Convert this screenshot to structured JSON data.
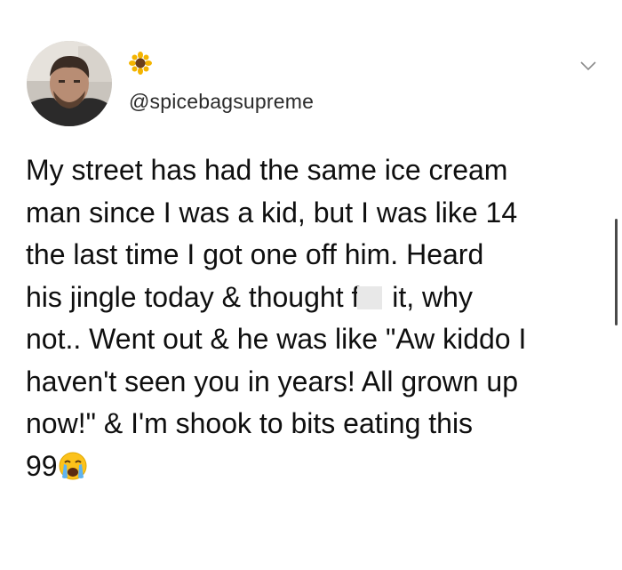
{
  "tweet": {
    "handle": "@spicebagsupreme",
    "name_emoji": "sunflower-icon",
    "lines": {
      "l1": "My street has had the same ice cream",
      "l2": "man since I was a kid, but I was like 14",
      "l3": "the last time I got one off him. Heard",
      "l4a": "his jingle today & thought f",
      "l4b": " it, why",
      "l5": "not.. Went out & he was like \"Aw kiddo I",
      "l6": "haven't seen you in years! All grown up",
      "l7": "now!\" & I'm shook to bits eating this",
      "l8": "99"
    },
    "end_emoji": "crying-face-icon"
  },
  "colors": {
    "text": "#0f0f0f",
    "handle": "#2b2b2b",
    "background": "#ffffff"
  }
}
